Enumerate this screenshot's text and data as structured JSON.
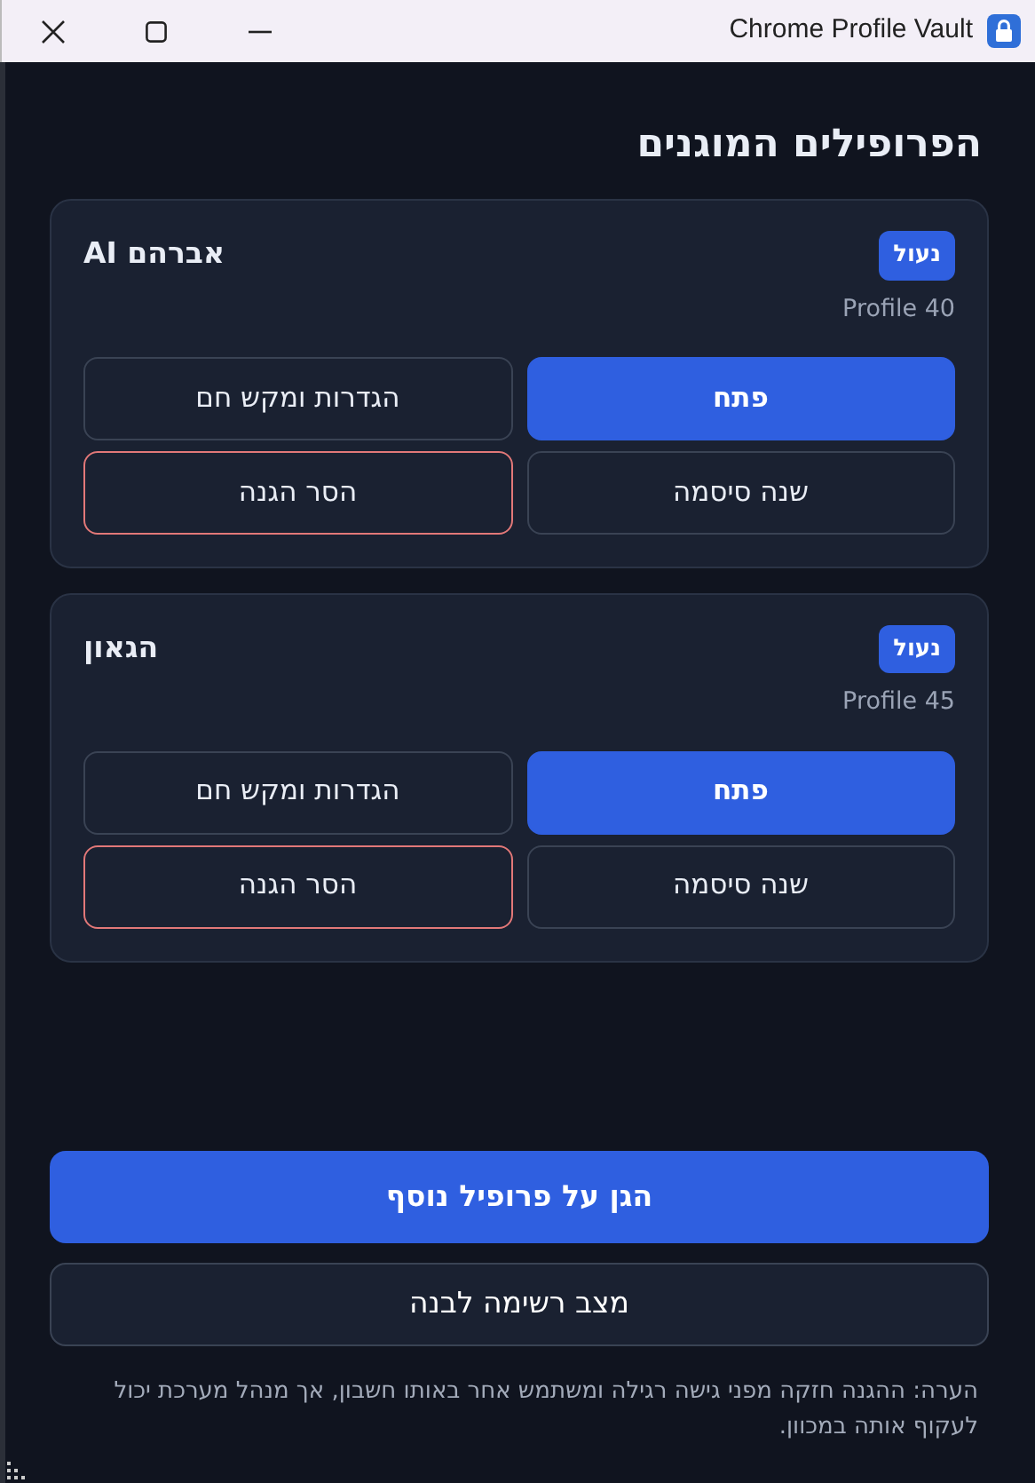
{
  "window": {
    "title": "Chrome Profile Vault"
  },
  "heading": "הפרופילים המוגנים",
  "profiles": [
    {
      "name": "אברהם AI",
      "badge": "נעול",
      "profile_dir": "Profile 40",
      "actions": [
        {
          "label": "פתח",
          "kind": "primary"
        },
        {
          "label": "הגדרות ומקש חם",
          "kind": "secondary"
        },
        {
          "label": "שנה סיסמה",
          "kind": "secondary"
        },
        {
          "label": "הסר הגנה",
          "kind": "danger"
        }
      ]
    },
    {
      "name": "הגאון",
      "badge": "נעול",
      "profile_dir": "Profile 45",
      "actions": [
        {
          "label": "פתח",
          "kind": "primary"
        },
        {
          "label": "הגדרות ומקש חם",
          "kind": "secondary"
        },
        {
          "label": "שנה סיסמה",
          "kind": "secondary"
        },
        {
          "label": "הסר הגנה",
          "kind": "danger"
        }
      ]
    }
  ],
  "buttons": [
    {
      "label": "הגן על פרופיל נוסף",
      "kind": "primary"
    },
    {
      "label": "מצב רשימה לבנה",
      "kind": "secondary"
    }
  ],
  "note": "הערה: ההגנה חזקה מפני גישה רגילה ומשתמש אחר באותו חשבון, אך מנהל מערכת יכול לעקוף אותה במכוון."
}
